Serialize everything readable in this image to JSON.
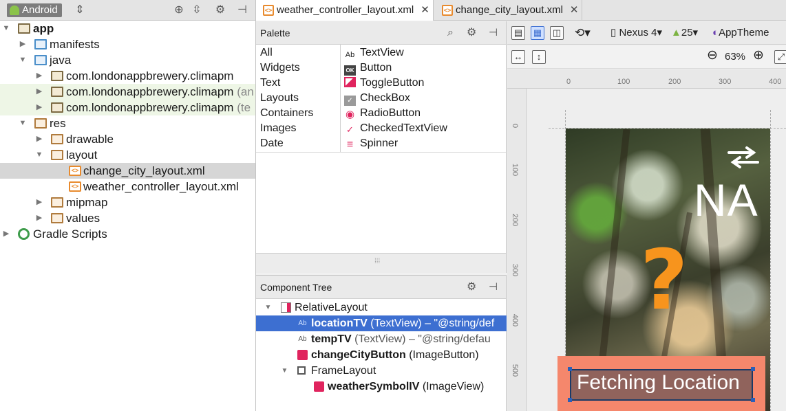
{
  "project_panel": {
    "view_selector": "Android",
    "tree": [
      {
        "label": "app",
        "bold": true
      },
      {
        "label": "manifests"
      },
      {
        "label": "java"
      },
      {
        "label": "com.londonappbrewery.climapm"
      },
      {
        "label": "com.londonappbrewery.climapm",
        "suffix": "(an"
      },
      {
        "label": "com.londonappbrewery.climapm",
        "suffix": "(te"
      },
      {
        "label": "res"
      },
      {
        "label": "drawable"
      },
      {
        "label": "layout"
      },
      {
        "label": "change_city_layout.xml"
      },
      {
        "label": "weather_controller_layout.xml"
      },
      {
        "label": "mipmap"
      },
      {
        "label": "values"
      },
      {
        "label": "Gradle Scripts"
      }
    ]
  },
  "tabs": [
    {
      "label": "weather_controller_layout.xml",
      "close": "✕",
      "active": true
    },
    {
      "label": "change_city_layout.xml",
      "close": "✕",
      "active": false
    }
  ],
  "palette": {
    "title": "Palette",
    "categories": [
      "All",
      "Widgets",
      "Text",
      "Layouts",
      "Containers",
      "Images",
      "Date"
    ],
    "items": [
      {
        "label": "TextView",
        "icon": "Ab"
      },
      {
        "label": "Button",
        "icon": "OK"
      },
      {
        "label": "ToggleButton",
        "icon": "toggle-icon"
      },
      {
        "label": "CheckBox",
        "icon": "checkbox-icon"
      },
      {
        "label": "RadioButton",
        "icon": "radio-icon"
      },
      {
        "label": "CheckedTextView",
        "icon": "checked-text-icon"
      },
      {
        "label": "Spinner",
        "icon": "spinner-icon"
      }
    ]
  },
  "component_tree": {
    "title": "Component Tree",
    "rows": [
      {
        "name": "RelativeLayout",
        "detail": ""
      },
      {
        "name": "locationTV",
        "detail": " (TextView) – \"@string/def"
      },
      {
        "name": "tempTV",
        "detail": " (TextView) – \"@string/defau"
      },
      {
        "name": "changeCityButton",
        "detail": " (ImageButton)"
      },
      {
        "name": "FrameLayout",
        "detail": ""
      },
      {
        "name": "weatherSymbolIV",
        "detail": " (ImageView)"
      }
    ],
    "icon_text": "Ab"
  },
  "designer": {
    "device": "Nexus 4",
    "api": "25",
    "theme": "AppTheme",
    "zoom": "63%",
    "ruler_top": [
      "0",
      "100",
      "200",
      "300",
      "400"
    ],
    "ruler_left": [
      "0",
      "100",
      "200",
      "300",
      "400",
      "500"
    ],
    "preview": {
      "temperature": "NA",
      "weather_symbol": "?",
      "location": "Fetching Location"
    },
    "accent_color": "#f5876c",
    "symbol_color": "#f7941d"
  }
}
